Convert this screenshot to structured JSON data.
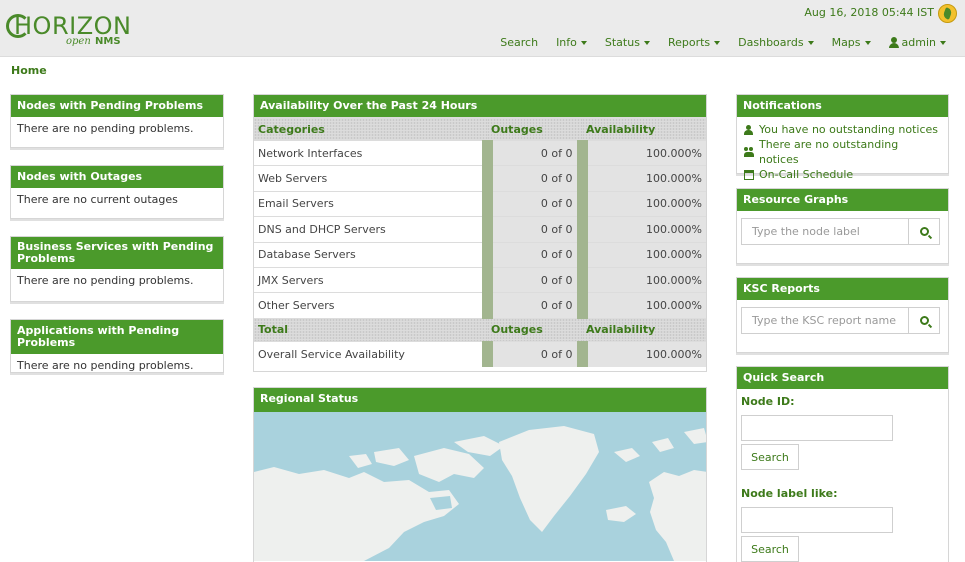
{
  "header": {
    "logo_main": "HORIZON",
    "logo_open": "open",
    "logo_nms": "NMS",
    "datetime": "Aug 16, 2018 05:44 IST",
    "nav": [
      {
        "label": "Search",
        "dropdown": false
      },
      {
        "label": "Info",
        "dropdown": true
      },
      {
        "label": "Status",
        "dropdown": true
      },
      {
        "label": "Reports",
        "dropdown": true
      },
      {
        "label": "Dashboards",
        "dropdown": true
      },
      {
        "label": "Maps",
        "dropdown": true
      }
    ],
    "user": "admin"
  },
  "breadcrumb": "Home",
  "left_panels": [
    {
      "title": "Nodes with Pending Problems",
      "body": "There are no pending problems."
    },
    {
      "title": "Nodes with Outages",
      "body": "There are no current outages"
    },
    {
      "title": "Business Services with Pending Problems",
      "body": "There are no pending problems."
    },
    {
      "title": "Applications with Pending Problems",
      "body": "There are no pending problems."
    }
  ],
  "availability": {
    "title": "Availability Over the Past 24 Hours",
    "headers": {
      "categories": "Categories",
      "outages": "Outages",
      "availability": "Availability"
    },
    "rows": [
      {
        "name": "Network Interfaces",
        "outages": "0 of 0",
        "availability": "100.000%"
      },
      {
        "name": "Web Servers",
        "outages": "0 of 0",
        "availability": "100.000%"
      },
      {
        "name": "Email Servers",
        "outages": "0 of 0",
        "availability": "100.000%"
      },
      {
        "name": "DNS and DHCP Servers",
        "outages": "0 of 0",
        "availability": "100.000%"
      },
      {
        "name": "Database Servers",
        "outages": "0 of 0",
        "availability": "100.000%"
      },
      {
        "name": "JMX Servers",
        "outages": "0 of 0",
        "availability": "100.000%"
      },
      {
        "name": "Other Servers",
        "outages": "0 of 0",
        "availability": "100.000%"
      }
    ],
    "total_headers": {
      "total": "Total",
      "outages": "Outages",
      "availability": "Availability"
    },
    "total_row": {
      "name": "Overall Service Availability",
      "outages": "0 of 0",
      "availability": "100.000%"
    }
  },
  "regional_status": {
    "title": "Regional Status"
  },
  "notifications": {
    "title": "Notifications",
    "items": [
      {
        "icon": "user-icon",
        "label": "You have no outstanding notices"
      },
      {
        "icon": "users-icon",
        "label": "There are no outstanding notices"
      },
      {
        "icon": "calendar-icon",
        "label": "On-Call Schedule"
      }
    ]
  },
  "resource_graphs": {
    "title": "Resource Graphs",
    "placeholder": "Type the node label"
  },
  "ksc_reports": {
    "title": "KSC Reports",
    "placeholder": "Type the KSC report name"
  },
  "quick_search": {
    "title": "Quick Search",
    "node_id_label": "Node ID:",
    "search_label": "Search",
    "node_label_label": "Node label like:",
    "search_label_2": "Search"
  },
  "colors": {
    "brand_green": "#4b9a2b",
    "link_green": "#3d7a1a",
    "map_water": "#a9d2dd"
  }
}
